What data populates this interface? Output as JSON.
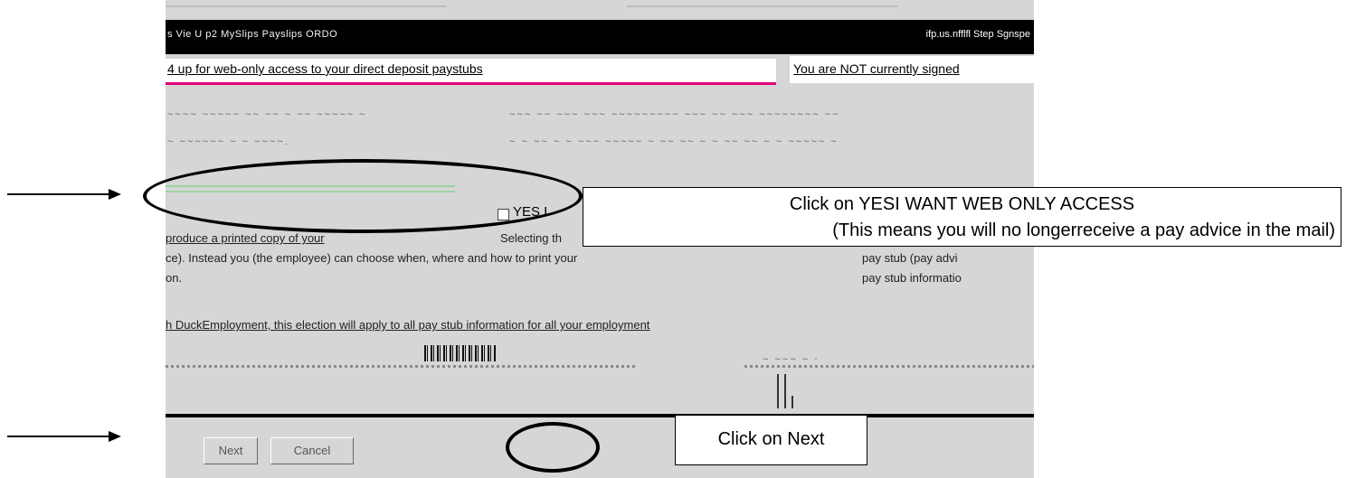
{
  "app": {
    "title_left": "s Vie U p2 MySlips Payslips ORDO",
    "title_right": "ifp.us.nfflfl Step Sgnspe"
  },
  "banner": {
    "left_text": "4 up for web-only access to your direct deposit paystubs",
    "right_text": "You are NOT currently signed"
  },
  "body": {
    "faint_line1_left": "~~~~ ~~~~~ ~~ ~~ ~ ~~ ~~~~~ ~",
    "faint_line1_right": "~~~ ~~ ~~~ ~~~ ~~~~~~~~~ ~~~ ~~ ~~~ ~~~~~~~~ ~~",
    "faint_line2_left": "~ ~~~~~~ ~ ~ ~~~~.",
    "faint_line2_right": "~ ~ ~~ ~ ~ ~~~ ~~~~~ ~ ~~ ~~ ~ ~ ~~ ~~ ~ ~ ~~~~~ ~",
    "yes_option_label": "YES I",
    "para_line1_left": "produce a printed copy of your",
    "para_line1_mid": "Selecting th",
    "para_line2_left": "ce). Instead you (the employee) can choose when, where and how to print your",
    "para_line2_right": "pay stub (pay advi",
    "para_line3_left": "on.",
    "para_line3_right": "pay stub informatio",
    "para_line4": "h DuckEmployment, this election will apply to all pay stub information for all your employment",
    "small_text": "~ ~~~ ~ ~~~ ~"
  },
  "buttons": {
    "next": "Next",
    "cancel": "Cancel"
  },
  "callouts": {
    "yes_line1": "Click on YESI WANT WEB ONLY ACCESS",
    "yes_line2": "(This means you will no longerreceive a pay advice in the mail)",
    "next": "Click on Next"
  }
}
